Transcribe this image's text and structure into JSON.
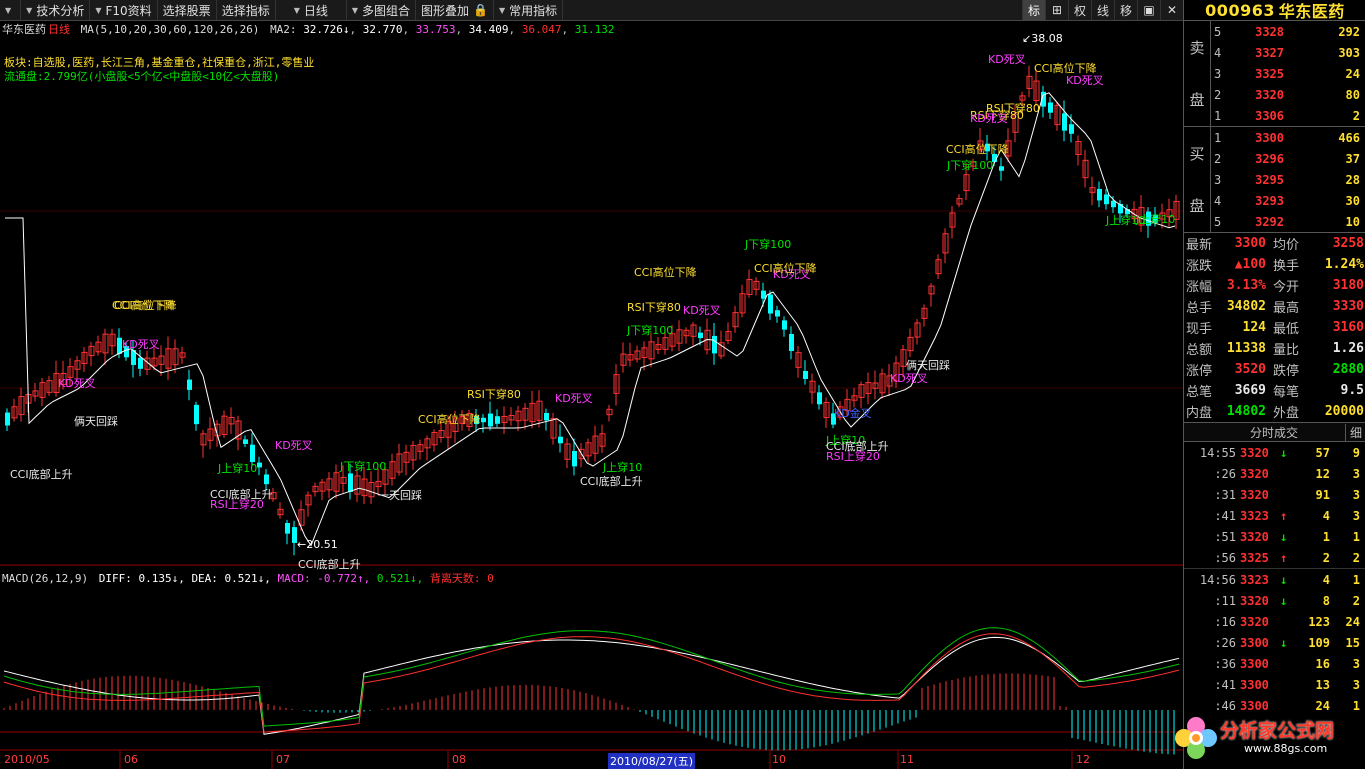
{
  "toolbar": {
    "items": [
      "技术分析",
      "F10资料",
      "选择股票",
      "选择指标",
      "日线",
      "多图组合",
      "图形叠加",
      "常用指标"
    ],
    "right_buttons": [
      "标",
      "⊞",
      "权",
      "线",
      "移",
      "▣",
      "✕"
    ]
  },
  "stock": {
    "code": "000963",
    "name": "华东医药"
  },
  "chart_header": {
    "title": "华东医药",
    "period": "日线",
    "ma_label": "MA(5,10,20,30,60,120,26,26)",
    "ma2_label": "MA2:",
    "ma_values": [
      "32.726↓",
      "32.770",
      "33.753",
      "34.409",
      "36.047",
      "31.132"
    ],
    "sector": "板块:自选股,医药,长江三角,基金重仓,社保重仓,浙江,零售业",
    "float": "流通盘:2.799亿(小盘股<5个亿<中盘股<10亿<大盘股)"
  },
  "macd": {
    "label": "MACD(26,12,9)",
    "diff": "DIFF: 0.135↓,",
    "dea": "DEA: 0.521↓,",
    "macd": "MACD: -0.772↑,",
    "extra": "0.521↓,",
    "days": "背离天数: 0"
  },
  "dates": [
    "2010/05",
    "06",
    "07",
    "08",
    "2010/08/27(五)",
    "10",
    "11",
    "12"
  ],
  "price_marks": {
    "low": "20.51",
    "high": "38.08"
  },
  "annotations": [
    {
      "text": "CCI高位下降",
      "c": "yellow"
    },
    {
      "text": "KD死叉",
      "c": "magenta"
    },
    {
      "text": "KD死叉",
      "c": "magenta"
    },
    {
      "text": "俩天回踩",
      "c": "white"
    },
    {
      "text": "CCI底部上升",
      "c": "white"
    },
    {
      "text": "KD死叉",
      "c": "magenta"
    },
    {
      "text": "J上穿10",
      "c": "green"
    },
    {
      "text": "CCI底部上升",
      "c": "white"
    },
    {
      "text": "RSI上穿20",
      "c": "magenta"
    },
    {
      "text": "CCI底部上升",
      "c": "white"
    },
    {
      "text": "J下穿100",
      "c": "green"
    },
    {
      "text": "一天回踩",
      "c": "white"
    },
    {
      "text": "CCI高位下降",
      "c": "yellow"
    },
    {
      "text": "RSI下穿80",
      "c": "yellow"
    },
    {
      "text": "CCI高位下降",
      "c": "yellow"
    },
    {
      "text": "KD死叉",
      "c": "magenta"
    },
    {
      "text": "J上穿10",
      "c": "green"
    },
    {
      "text": "CCI底部上升",
      "c": "white"
    },
    {
      "text": "CCI高位下降",
      "c": "yellow"
    },
    {
      "text": "RSI下穿80",
      "c": "yellow"
    },
    {
      "text": "J下穿100",
      "c": "green"
    },
    {
      "text": "KD死叉",
      "c": "magenta"
    },
    {
      "text": "J下穿100",
      "c": "green"
    },
    {
      "text": "CCI高位下降",
      "c": "yellow"
    },
    {
      "text": "KD死叉",
      "c": "magenta"
    },
    {
      "text": "俩天回踩",
      "c": "white"
    },
    {
      "text": "KD死叉",
      "c": "magenta"
    },
    {
      "text": "KD金叉",
      "c": "blue"
    },
    {
      "text": "J上穿10",
      "c": "green"
    },
    {
      "text": "CCI底部上升",
      "c": "white"
    },
    {
      "text": "RSI上穿20",
      "c": "magenta"
    },
    {
      "text": "CCI高位下降",
      "c": "yellow"
    },
    {
      "text": "J下穿100",
      "c": "green"
    },
    {
      "text": "RSI下穿80",
      "c": "yellow"
    },
    {
      "text": "KD死叉",
      "c": "magenta"
    },
    {
      "text": "RSI下穿80",
      "c": "yellow"
    },
    {
      "text": "KD死叉",
      "c": "magenta"
    },
    {
      "text": "CCI高位下降",
      "c": "yellow"
    },
    {
      "text": "KD死叉",
      "c": "magenta"
    },
    {
      "text": "J上穿10",
      "c": "green"
    },
    {
      "text": "J上穿10",
      "c": "green"
    }
  ],
  "order_book": {
    "sell_label": [
      "卖",
      "盘"
    ],
    "buy_label": [
      "买",
      "盘"
    ],
    "sell": [
      {
        "lv": "5",
        "price": "3328",
        "vol": "292"
      },
      {
        "lv": "4",
        "price": "3327",
        "vol": "303"
      },
      {
        "lv": "3",
        "price": "3325",
        "vol": "24"
      },
      {
        "lv": "2",
        "price": "3320",
        "vol": "80"
      },
      {
        "lv": "1",
        "price": "3306",
        "vol": "2"
      }
    ],
    "buy": [
      {
        "lv": "1",
        "price": "3300",
        "vol": "466"
      },
      {
        "lv": "2",
        "price": "3296",
        "vol": "37"
      },
      {
        "lv": "3",
        "price": "3295",
        "vol": "28"
      },
      {
        "lv": "4",
        "price": "3293",
        "vol": "30"
      },
      {
        "lv": "5",
        "price": "3292",
        "vol": "10"
      }
    ]
  },
  "quote": [
    {
      "l": "最新",
      "v": "3300",
      "vc": "red",
      "l2": "均价",
      "v2": "3258",
      "v2c": "red"
    },
    {
      "l": "涨跌",
      "v": "▲100",
      "vc": "red",
      "l2": "换手",
      "v2": "1.24%",
      "v2c": "yellow"
    },
    {
      "l": "涨幅",
      "v": "3.13%",
      "vc": "red",
      "l2": "今开",
      "v2": "3180",
      "v2c": "red"
    },
    {
      "l": "总手",
      "v": "34802",
      "vc": "yellow",
      "l2": "最高",
      "v2": "3330",
      "v2c": "red"
    },
    {
      "l": "现手",
      "v": "124",
      "vc": "yellow",
      "l2": "最低",
      "v2": "3160",
      "v2c": "red"
    },
    {
      "l": "总额",
      "v": "11338",
      "vc": "yellow",
      "l2": "量比",
      "v2": "1.26",
      "v2c": "white"
    },
    {
      "l": "涨停",
      "v": "3520",
      "vc": "red",
      "l2": "跌停",
      "v2": "2880",
      "v2c": "green"
    },
    {
      "l": "总笔",
      "v": "3669",
      "vc": "white",
      "l2": "每笔",
      "v2": "9.5",
      "v2c": "white"
    },
    {
      "l": "内盘",
      "v": "14802",
      "vc": "green",
      "l2": "外盘",
      "v2": "20000",
      "v2c": "yellow"
    }
  ],
  "ticks_header": {
    "label": "分时成交",
    "tab": "细"
  },
  "ticks": [
    {
      "t": "14:55",
      "p": "3320",
      "a": "↓",
      "ac": "green",
      "v": "57",
      "n": "9"
    },
    {
      "t": ":26",
      "p": "3320",
      "a": "",
      "ac": "",
      "v": "12",
      "n": "3"
    },
    {
      "t": ":31",
      "p": "3320",
      "a": "",
      "ac": "",
      "v": "91",
      "n": "3"
    },
    {
      "t": ":41",
      "p": "3323",
      "a": "↑",
      "ac": "red",
      "v": "4",
      "n": "3"
    },
    {
      "t": ":51",
      "p": "3320",
      "a": "↓",
      "ac": "green",
      "v": "1",
      "n": "1"
    },
    {
      "t": ":56",
      "p": "3325",
      "a": "↑",
      "ac": "red",
      "v": "2",
      "n": "2"
    },
    {
      "t": "14:56",
      "p": "3323",
      "a": "↓",
      "ac": "green",
      "v": "4",
      "n": "1"
    },
    {
      "t": ":11",
      "p": "3320",
      "a": "↓",
      "ac": "green",
      "v": "8",
      "n": "2"
    },
    {
      "t": ":16",
      "p": "3320",
      "a": "",
      "ac": "",
      "v": "123",
      "n": "24"
    },
    {
      "t": ":26",
      "p": "3300",
      "a": "↓",
      "ac": "green",
      "v": "109",
      "n": "15"
    },
    {
      "t": ":36",
      "p": "3300",
      "a": "",
      "ac": "",
      "v": "16",
      "n": "3"
    },
    {
      "t": ":41",
      "p": "3300",
      "a": "",
      "ac": "",
      "v": "13",
      "n": "3"
    },
    {
      "t": ":46",
      "p": "3300",
      "a": "",
      "ac": "",
      "v": "24",
      "n": "1"
    }
  ],
  "watermark": {
    "text": "分析家公式网",
    "url": "www.88gs.com"
  },
  "colors": {
    "up": "#ff3232",
    "down": "#00ffff",
    "ma": "#ffffff",
    "dea": "#ff3030",
    "diff": "#ffffff",
    "signal_green": "#00c000"
  }
}
